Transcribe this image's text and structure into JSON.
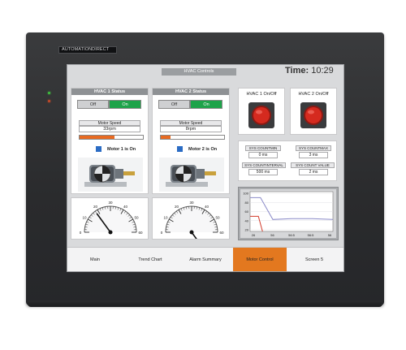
{
  "device": {
    "brand": "AUTOMATIONDIRECT"
  },
  "header": {
    "title": "HVAC Controls",
    "time_label": "Time:",
    "time_value": "10:29"
  },
  "hvac": [
    {
      "title": "HVAC 1 Status",
      "off_label": "Off",
      "on_label": "On",
      "speed_label": "Motor Speed",
      "speed_value": "33rpm",
      "speed_level": 0.55,
      "status": "Motor 1 is On",
      "gauge_needle_value": 18
    },
    {
      "title": "HVAC 2 Status",
      "off_label": "Off",
      "on_label": "On",
      "speed_label": "Motor Speed",
      "speed_value": "8rpm",
      "speed_level": 0.15,
      "status": "Motor 2 is On",
      "gauge_needle_value": 78
    }
  ],
  "gauge_ticks": [
    "0",
    "10",
    "20",
    "30",
    "40",
    "50",
    "60"
  ],
  "pushbuttons": [
    {
      "label": "HVAC 1 On/Off"
    },
    {
      "label": "HVAC 2 On/Off"
    }
  ],
  "system": {
    "countmin_label": "SYS COUNTMIN",
    "countmin_value": "0 ms",
    "countmax_label": "SYS COUNTMAX",
    "countmax_value": "3 ms",
    "countinterval_label": "SYS COUNTINTERVAL",
    "countinterval_value": "500 ms",
    "countvalue_label": "SYS COUNT VALUE",
    "countvalue_value": "2 ms"
  },
  "trend": {
    "y_ticks": [
      "100",
      "80",
      "60",
      "40",
      "20"
    ],
    "x_ticks": [
      "26",
      "56",
      "56:5",
      "56:5",
      "56"
    ],
    "series": [
      {
        "color": "#8a8ac8",
        "points": [
          [
            0,
            85
          ],
          [
            1,
            85
          ],
          [
            2.2,
            30
          ],
          [
            4,
            32
          ],
          [
            6,
            32
          ],
          [
            8,
            30
          ]
        ]
      },
      {
        "color": "#d23a2a",
        "points": [
          [
            0,
            38
          ],
          [
            0.8,
            38
          ],
          [
            1.2,
            0
          ]
        ]
      }
    ]
  },
  "nav": {
    "items": [
      "Main",
      "Trend Chart",
      "Alarm Summary",
      "Motor Control",
      "Screen 5"
    ],
    "active_index": 3
  }
}
